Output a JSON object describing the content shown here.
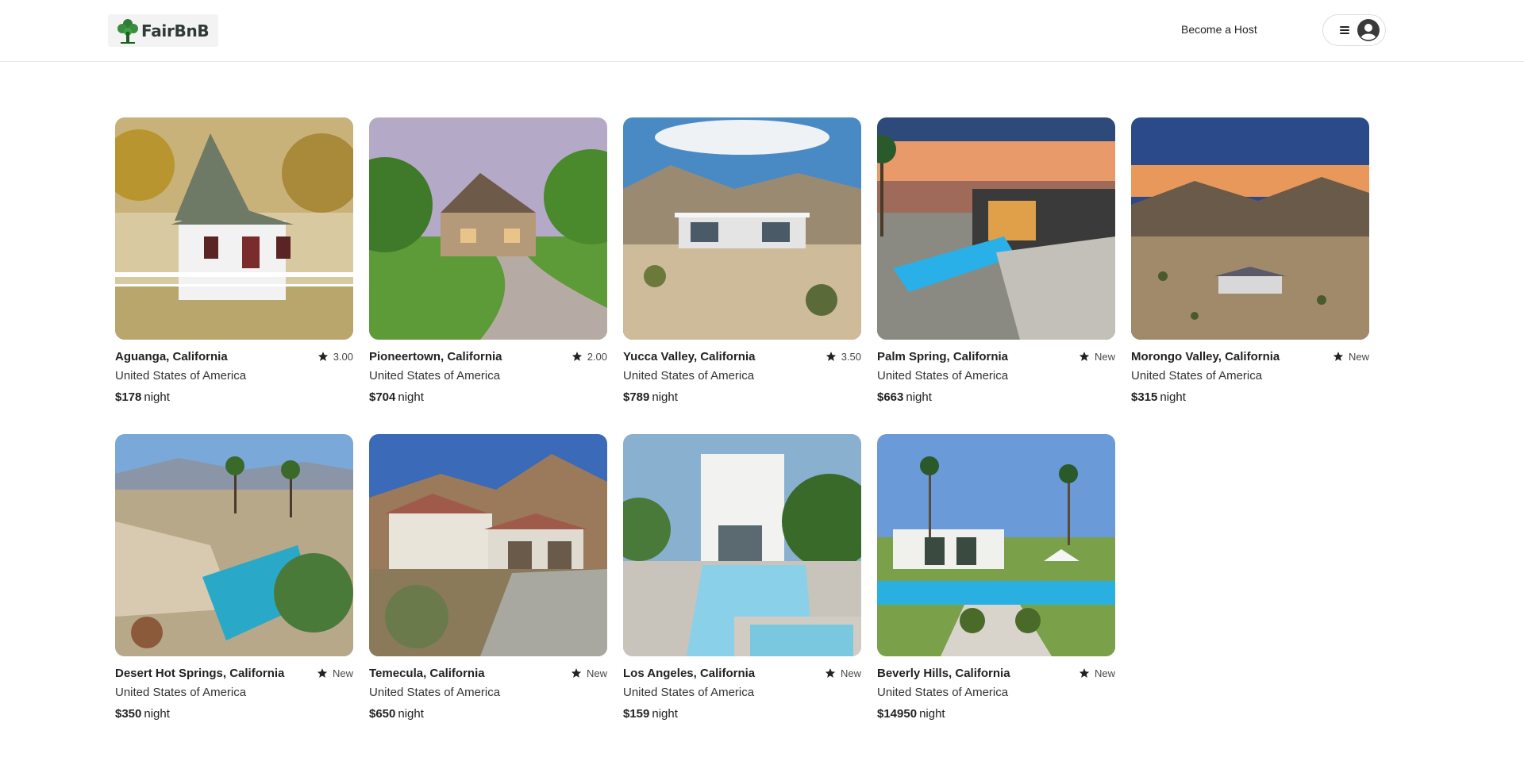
{
  "header": {
    "logo_text": "FairBnB",
    "become_host_label": "Become a Host",
    "menu_icon": "hamburger-menu-icon",
    "avatar_icon": "user-avatar-icon"
  },
  "colors": {
    "logo_green": "#2e7d32",
    "border": "#dddddd",
    "text": "#222222"
  },
  "listings": [
    {
      "title": "Aguanga, California",
      "country": "United States of America",
      "price": "$178",
      "per": "night",
      "rating": "3.00"
    },
    {
      "title": "Pioneertown, California",
      "country": "United States of America",
      "price": "$704",
      "per": "night",
      "rating": "2.00"
    },
    {
      "title": "Yucca Valley, California",
      "country": "United States of America",
      "price": "$789",
      "per": "night",
      "rating": "3.50"
    },
    {
      "title": "Palm Spring, California",
      "country": "United States of America",
      "price": "$663",
      "per": "night",
      "rating": "New"
    },
    {
      "title": "Morongo Valley, California",
      "country": "United States of America",
      "price": "$315",
      "per": "night",
      "rating": "New"
    },
    {
      "title": "Desert Hot Springs, California",
      "country": "United States of America",
      "price": "$350",
      "per": "night",
      "rating": "New"
    },
    {
      "title": "Temecula, California",
      "country": "United States of America",
      "price": "$650",
      "per": "night",
      "rating": "New"
    },
    {
      "title": "Los Angeles, California",
      "country": "United States of America",
      "price": "$159",
      "per": "night",
      "rating": "New"
    },
    {
      "title": "Beverly Hills, California",
      "country": "United States of America",
      "price": "$14950",
      "per": "night",
      "rating": "New"
    }
  ]
}
